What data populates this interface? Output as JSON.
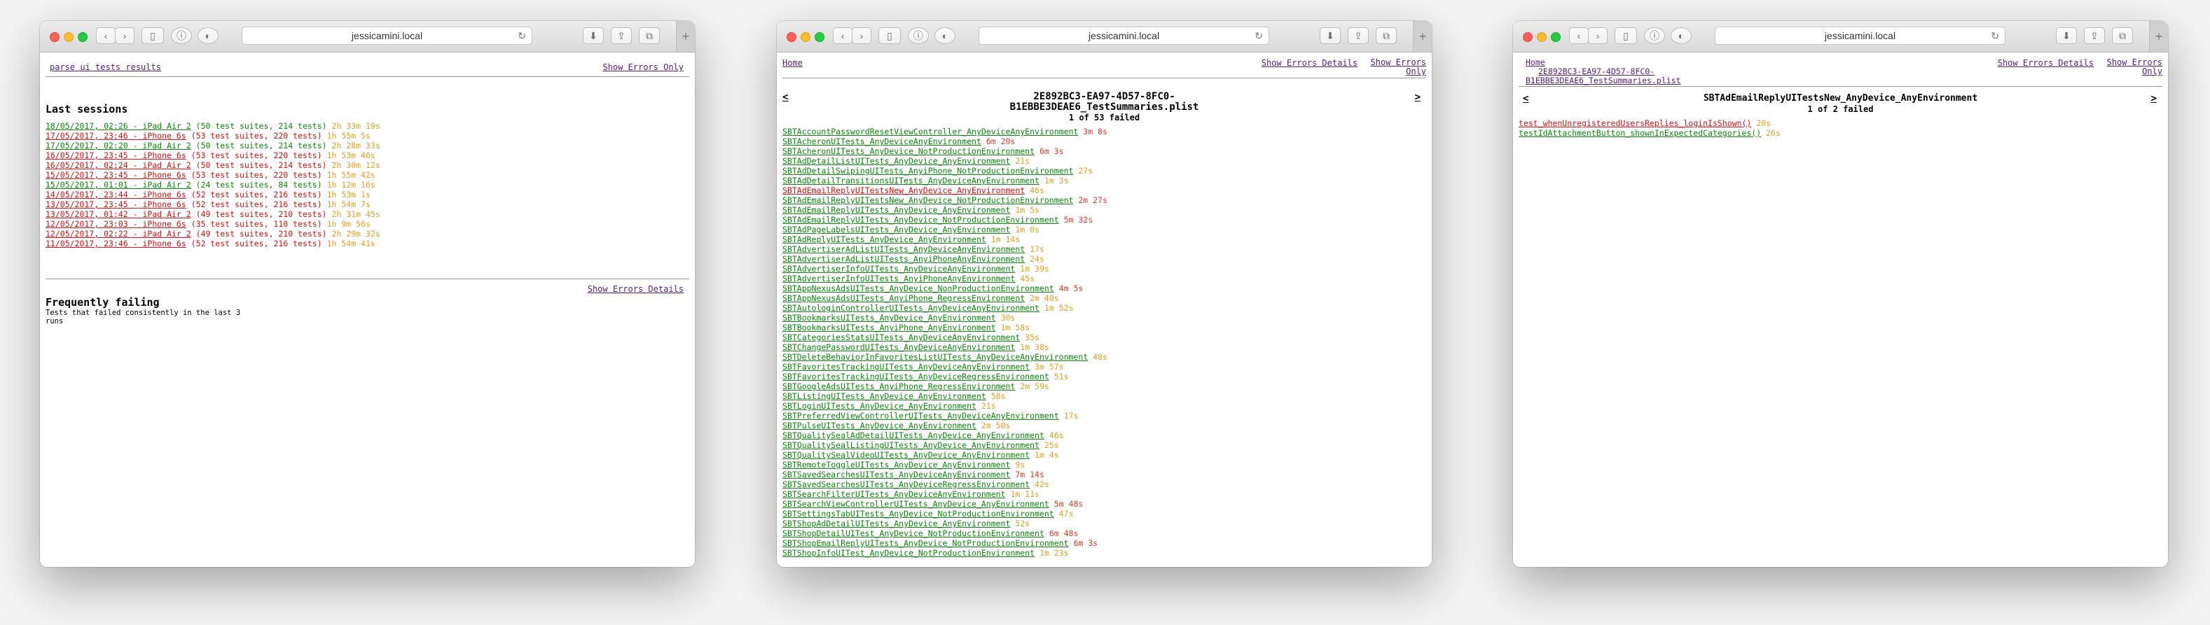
{
  "browser": {
    "address": "jessicamini.local"
  },
  "win1": {
    "top_link": "parse ui tests results",
    "show_errors_only": "Show Errors Only",
    "last_sessions_heading": "Last sessions",
    "sessions": [
      {
        "link": "18/05/2017, 02:26 - iPad Air 2",
        "info": " (50 test suites, 214 tests) ",
        "duration": "2h 33m 19s",
        "status": "ok",
        "dcolor": "d-orange"
      },
      {
        "link": "17/05/2017, 23:46 - iPhone 6s",
        "info": " (53 test suites, 220 tests) ",
        "duration": "1h 55m 5s",
        "status": "bad",
        "dcolor": "d-orange"
      },
      {
        "link": "17/05/2017, 02:20 - iPad Air 2",
        "info": " (50 test suites, 214 tests) ",
        "duration": "2h 28m 33s",
        "status": "ok",
        "dcolor": "d-orange"
      },
      {
        "link": "16/05/2017, 23:45 - iPhone 6s",
        "info": " (53 test suites, 220 tests) ",
        "duration": "1h 53m 46s",
        "status": "bad",
        "dcolor": "d-orange"
      },
      {
        "link": "16/05/2017, 02:24 - iPad Air 2",
        "info": " (50 test suites, 214 tests) ",
        "duration": "2h 30m 12s",
        "status": "bad",
        "dcolor": "d-orange"
      },
      {
        "link": "15/05/2017, 23:45 - iPhone 6s",
        "info": " (53 test suites, 220 tests) ",
        "duration": "1h 55m 42s",
        "status": "bad",
        "dcolor": "d-orange"
      },
      {
        "link": "15/05/2017, 01:01 - iPad Air 2",
        "info": " (24 test suites, 84 tests) ",
        "duration": "1h 12m 16s",
        "status": "ok",
        "dcolor": "d-orange"
      },
      {
        "link": "14/05/2017, 23:44 - iPhone 6s",
        "info": " (52 test suites, 216 tests) ",
        "duration": "1h 53m 1s",
        "status": "bad",
        "dcolor": "d-orange"
      },
      {
        "link": "13/05/2017, 23:45 - iPhone 6s",
        "info": " (52 test suites, 216 tests) ",
        "duration": "1h 54m 7s",
        "status": "bad",
        "dcolor": "d-orange"
      },
      {
        "link": "13/05/2017, 01:42 - iPad Air 2",
        "info": " (49 test suites, 210 tests) ",
        "duration": "2h 31m 45s",
        "status": "bad",
        "dcolor": "d-orange"
      },
      {
        "link": "12/05/2017, 23:03 - iPhone 6s",
        "info": " (35 test suites, 110 tests) ",
        "duration": "1h 9m 56s",
        "status": "bad",
        "dcolor": "d-orange"
      },
      {
        "link": "12/05/2017, 02:22 - iPad Air 2",
        "info": " (49 test suites, 210 tests) ",
        "duration": "2h 29m 32s",
        "status": "bad",
        "dcolor": "d-orange"
      },
      {
        "link": "11/05/2017, 23:46 - iPhone 6s",
        "info": " (52 test suites, 216 tests) ",
        "duration": "1h 54m 41s",
        "status": "bad",
        "dcolor": "d-orange"
      }
    ],
    "show_errors_details": "Show Errors Details",
    "frequently_failing_heading": "Frequently failing",
    "frequently_failing_note_1": "Tests that failed consistently in the last 3",
    "frequently_failing_note_2": "runs"
  },
  "win2": {
    "home": "Home",
    "show_errors_details": "Show Errors Details",
    "show_errors_only_1": "Show Errors",
    "show_errors_only_2": "Only",
    "prev": "<",
    "next": ">",
    "title_1": "2E892BC3-EA97-4D57-8FC0-",
    "title_2": "B1EBBE3DEAE6_TestSummaries.plist",
    "summary": "1 of 53 failed",
    "suites": [
      {
        "name": "SBTAccountPasswordResetViewController_AnyDeviceAnyEnvironment",
        "duration": "3m 8s",
        "status": "ok",
        "dcolor": "d-red"
      },
      {
        "name": "SBTAcheronUITests_AnyDeviceAnyEnvironment",
        "duration": "6m 20s",
        "status": "ok",
        "dcolor": "d-red"
      },
      {
        "name": "SBTAcheronUITests_AnyDevice_NotProductionEnvironment",
        "duration": "6m 3s",
        "status": "ok",
        "dcolor": "d-red"
      },
      {
        "name": "SBTAdDetailListUITests_AnyDevice_AnyEnvironment",
        "duration": "21s",
        "status": "ok",
        "dcolor": "d-orange"
      },
      {
        "name": "SBTAdDetailSwipingUITests_AnyiPhone_NotProductionEnvironment",
        "duration": "27s",
        "status": "ok",
        "dcolor": "d-orange"
      },
      {
        "name": "SBTAdDetailTransitionsUITests_AnyDeviceAnyEnvironment",
        "duration": "1m 3s",
        "status": "ok",
        "dcolor": "d-orange"
      },
      {
        "name": "SBTAdEmailReplyUITestsNew_AnyDevice_AnyEnvironment",
        "duration": "46s",
        "status": "bad",
        "dcolor": "d-orange"
      },
      {
        "name": "SBTAdEmailReplyUITestsNew_AnyDevice_NotProductionEnvironment",
        "duration": "2m 27s",
        "status": "ok",
        "dcolor": "d-red"
      },
      {
        "name": "SBTAdEmailReplyUITests_AnyDevice_AnyEnvironment",
        "duration": "1m 5s",
        "status": "ok",
        "dcolor": "d-orange"
      },
      {
        "name": "SBTAdEmailReplyUITests_AnyDevice_NotProductionEnvironment",
        "duration": "5m 32s",
        "status": "ok",
        "dcolor": "d-red"
      },
      {
        "name": "SBTAdPageLabelsUITests_AnyDevice_AnyEnvironment",
        "duration": "1m 0s",
        "status": "ok",
        "dcolor": "d-orange"
      },
      {
        "name": "SBTAdReplyUITests_AnyDevice_AnyEnvironment",
        "duration": "1m 14s",
        "status": "ok",
        "dcolor": "d-orange"
      },
      {
        "name": "SBTAdvertiserAdListUITests_AnyDeviceAnyEnvironment",
        "duration": "17s",
        "status": "ok",
        "dcolor": "d-orange"
      },
      {
        "name": "SBTAdvertiserAdListUITests_AnyiPhoneAnyEnvironment",
        "duration": "24s",
        "status": "ok",
        "dcolor": "d-orange"
      },
      {
        "name": "SBTAdvertiserInfoUITests_AnyDeviceAnyEnvironment",
        "duration": "1m 39s",
        "status": "ok",
        "dcolor": "d-orange"
      },
      {
        "name": "SBTAdvertiserInfoUITests_AnyiPhoneAnyEnvironment",
        "duration": "45s",
        "status": "ok",
        "dcolor": "d-orange"
      },
      {
        "name": "SBTAppNexusAdsUITests_AnyDevice_NonProductionEnvironment",
        "duration": "4m 5s",
        "status": "ok",
        "dcolor": "d-red"
      },
      {
        "name": "SBTAppNexusAdsUITests_AnyiPhone_RegressEnvironment",
        "duration": "2m 40s",
        "status": "ok",
        "dcolor": "d-orange"
      },
      {
        "name": "SBTAutologinControllerUITests_AnyDeviceAnyEnvironment",
        "duration": "1m 52s",
        "status": "ok",
        "dcolor": "d-orange"
      },
      {
        "name": "SBTBookmarksUITests_AnyDevice_AnyEnvironment",
        "duration": "30s",
        "status": "ok",
        "dcolor": "d-orange"
      },
      {
        "name": "SBTBookmarksUITests_AnyiPhone_AnyEnvironment",
        "duration": "1m 58s",
        "status": "ok",
        "dcolor": "d-orange"
      },
      {
        "name": "SBTCategoriesStatsUITests_AnyDeviceAnyEnvironment",
        "duration": "35s",
        "status": "ok",
        "dcolor": "d-orange"
      },
      {
        "name": "SBTChangePasswordUITests_AnyDeviceAnyEnvironment",
        "duration": "1m 38s",
        "status": "ok",
        "dcolor": "d-orange"
      },
      {
        "name": "SBTDeleteBehaviorInFavoritesListUITests_AnyDeviceAnyEnvironment",
        "duration": "48s",
        "status": "ok",
        "dcolor": "d-orange"
      },
      {
        "name": "SBTFavoritesTrackingUITests_AnyDeviceAnyEnvironment",
        "duration": "3m 57s",
        "status": "ok",
        "dcolor": "d-orange"
      },
      {
        "name": "SBTFavoritesTrackingUITests_AnyDeviceRegressEnvironment",
        "duration": "51s",
        "status": "ok",
        "dcolor": "d-orange"
      },
      {
        "name": "SBTGoogleAdsUITests_AnyiPhone_RegressEnvironment",
        "duration": "2m 59s",
        "status": "ok",
        "dcolor": "d-orange"
      },
      {
        "name": "SBTListingUITests_AnyDevice_AnyEnvironment",
        "duration": "58s",
        "status": "ok",
        "dcolor": "d-orange"
      },
      {
        "name": "SBTLoginUITests_AnyDevice_AnyEnvironment",
        "duration": "21s",
        "status": "ok",
        "dcolor": "d-orange"
      },
      {
        "name": "SBTPreferredViewControllerUITests_AnyDeviceAnyEnvironment",
        "duration": "17s",
        "status": "ok",
        "dcolor": "d-orange"
      },
      {
        "name": "SBTPulseUITests_AnyDevice_AnyEnvironment",
        "duration": "2m 50s",
        "status": "ok",
        "dcolor": "d-orange"
      },
      {
        "name": "SBTQualitySealAdDetailUITests_AnyDevice_AnyEnvironment",
        "duration": "46s",
        "status": "ok",
        "dcolor": "d-orange"
      },
      {
        "name": "SBTQualitySealListingUITests_AnyDevice_AnyEnvironment",
        "duration": "25s",
        "status": "ok",
        "dcolor": "d-orange"
      },
      {
        "name": "SBTQualitySealVideoUITests_AnyDevice_AnyEnvironment",
        "duration": "1m 4s",
        "status": "ok",
        "dcolor": "d-orange"
      },
      {
        "name": "SBTRemoteToggleUITests_AnyDevice_AnyEnvironment",
        "duration": "9s",
        "status": "ok",
        "dcolor": "d-orange"
      },
      {
        "name": "SBTSavedSearchesUITests_AnyDeviceAnyEnvironment",
        "duration": "7m 14s",
        "status": "ok",
        "dcolor": "d-red"
      },
      {
        "name": "SBTSavedSearchesUITests_AnyDeviceRegressEnvironment",
        "duration": "42s",
        "status": "ok",
        "dcolor": "d-orange"
      },
      {
        "name": "SBTSearchFilterUITests_AnyDeviceAnyEnvironment",
        "duration": "1m 11s",
        "status": "ok",
        "dcolor": "d-orange"
      },
      {
        "name": "SBTSearchViewControllerUITests_AnyDevice_AnyEnvironment",
        "duration": "5m 48s",
        "status": "ok",
        "dcolor": "d-red"
      },
      {
        "name": "SBTSettingsTabUITests_AnyDevice_NotProductionEnvironment",
        "duration": "47s",
        "status": "ok",
        "dcolor": "d-orange"
      },
      {
        "name": "SBTShopAdDetailUITests_AnyDevice_AnyEnvironment",
        "duration": "52s",
        "status": "ok",
        "dcolor": "d-orange"
      },
      {
        "name": "SBTShopDetailUITest_AnyDevice_NotProductionEnvironment",
        "duration": "6m 48s",
        "status": "ok",
        "dcolor": "d-red"
      },
      {
        "name": "SBTShopEmailReplyUITests_AnyDevice_NotProductionEnvironment",
        "duration": "6m 3s",
        "status": "ok",
        "dcolor": "d-red"
      },
      {
        "name": "SBTShopInfoUITest_AnyDevice_NotProductionEnvironment",
        "duration": "1m 23s",
        "status": "ok",
        "dcolor": "d-orange"
      }
    ]
  },
  "win3": {
    "home": "Home",
    "plist_1": "2E892BC3-EA97-4D57-8FC0-",
    "plist_2": "B1EBBE3DEAE6_TestSummaries.plist",
    "show_errors_details": "Show Errors Details",
    "show_errors_only_1": "Show Errors",
    "show_errors_only_2": "Only",
    "prev": "<",
    "next": ">",
    "title": "SBTAdEmailReplyUITestsNew_AnyDevice_AnyEnvironment",
    "summary": "1 of 2 failed",
    "tests": [
      {
        "name": "test_whenUnregisteredUsersReplies_loginIsShown()",
        "duration": "20s",
        "status": "bad",
        "dcolor": "d-orange"
      },
      {
        "name": "testIdAttachmentButton_shownInExpectedCategories()",
        "duration": "26s",
        "status": "ok",
        "dcolor": "d-orange"
      }
    ]
  }
}
